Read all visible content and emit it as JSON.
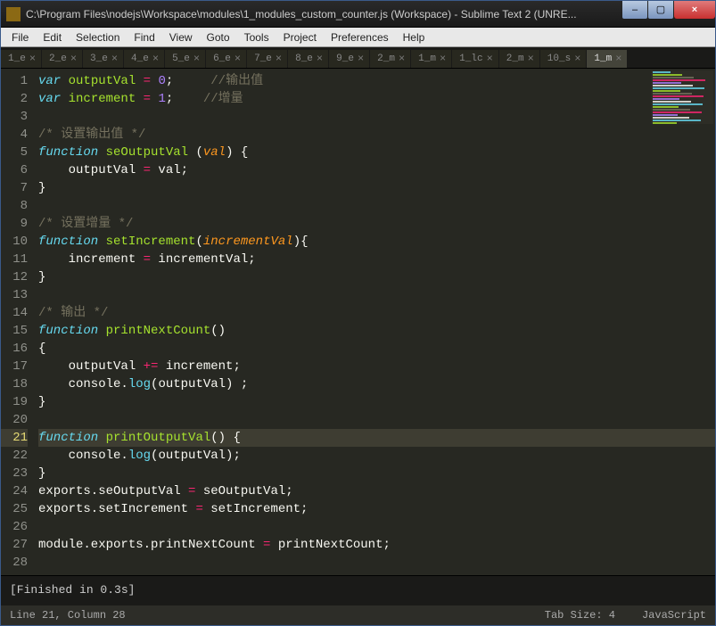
{
  "titlebar": "C:\\Program Files\\nodejs\\Workspace\\modules\\1_modules_custom_counter.js (Workspace) - Sublime Text 2 (UNRE...",
  "menu": [
    "File",
    "Edit",
    "Selection",
    "Find",
    "View",
    "Goto",
    "Tools",
    "Project",
    "Preferences",
    "Help"
  ],
  "tabs": [
    "1_e",
    "2_e",
    "3_e",
    "4_e",
    "5_e",
    "6_e",
    "7_e",
    "8_e",
    "9_e",
    "2_m",
    "1_m",
    "1_lc",
    "2_m",
    "10_s",
    "1_m"
  ],
  "active_tab_index": 14,
  "window_controls": {
    "min": "–",
    "max": "▢",
    "close": "×"
  },
  "tab_close_glyph": "×",
  "code_lines": [
    [
      [
        "decl",
        "var "
      ],
      [
        "name",
        "outputVal"
      ],
      [
        "",
        ""
      ],
      [
        "",
        " "
      ],
      [
        "op",
        "="
      ],
      [
        "",
        " "
      ],
      [
        "num",
        "0"
      ],
      [
        "",
        ";     "
      ],
      [
        "cmt",
        "//输出值"
      ]
    ],
    [
      [
        "decl",
        "var "
      ],
      [
        "name",
        "increment"
      ],
      [
        "",
        " "
      ],
      [
        "op",
        "="
      ],
      [
        "",
        " "
      ],
      [
        "num",
        "1"
      ],
      [
        "",
        ";    "
      ],
      [
        "cmt",
        "//增量"
      ]
    ],
    [
      [
        "",
        ""
      ]
    ],
    [
      [
        "cmt",
        "/* 设置输出值 */"
      ]
    ],
    [
      [
        "decl",
        "function"
      ],
      [
        "",
        " "
      ],
      [
        "name",
        "seOutputVal"
      ],
      [
        "",
        " ("
      ],
      [
        "str-param",
        "val"
      ],
      [
        "",
        ") {"
      ]
    ],
    [
      [
        "",
        "    outputVal "
      ],
      [
        "op",
        "="
      ],
      [
        "",
        " val;"
      ]
    ],
    [
      [
        "",
        "}"
      ]
    ],
    [
      [
        "",
        ""
      ]
    ],
    [
      [
        "cmt",
        "/* 设置增量 */"
      ]
    ],
    [
      [
        "decl",
        "function"
      ],
      [
        "",
        " "
      ],
      [
        "name",
        "setIncrement"
      ],
      [
        "",
        "("
      ],
      [
        "str-param",
        "incrementVal"
      ],
      [
        "",
        "){"
      ]
    ],
    [
      [
        "",
        "    increment "
      ],
      [
        "op",
        "="
      ],
      [
        "",
        " incrementVal;"
      ]
    ],
    [
      [
        "",
        "}"
      ]
    ],
    [
      [
        "",
        ""
      ]
    ],
    [
      [
        "cmt",
        "/* 输出 */"
      ]
    ],
    [
      [
        "decl",
        "function"
      ],
      [
        "",
        " "
      ],
      [
        "name",
        "printNextCount"
      ],
      [
        "",
        "()"
      ]
    ],
    [
      [
        "",
        "{"
      ]
    ],
    [
      [
        "",
        "    outputVal "
      ],
      [
        "op",
        "+="
      ],
      [
        "",
        " increment;"
      ]
    ],
    [
      [
        "",
        "    console."
      ],
      [
        "fn",
        "log"
      ],
      [
        "",
        "(outputVal) ;"
      ]
    ],
    [
      [
        "",
        "}"
      ]
    ],
    [
      [
        "",
        ""
      ]
    ],
    [
      [
        "decl",
        "function"
      ],
      [
        "",
        " "
      ],
      [
        "name",
        "printOutputVal"
      ],
      [
        "",
        "() {"
      ]
    ],
    [
      [
        "",
        "    console."
      ],
      [
        "fn",
        "log"
      ],
      [
        "",
        "(outputVal);"
      ]
    ],
    [
      [
        "",
        "}"
      ]
    ],
    [
      [
        "",
        "exports.seOutputVal "
      ],
      [
        "op",
        "="
      ],
      [
        "",
        " seOutputVal;"
      ]
    ],
    [
      [
        "",
        "exports.setIncrement "
      ],
      [
        "op",
        "="
      ],
      [
        "",
        " setIncrement;"
      ]
    ],
    [
      [
        "",
        ""
      ]
    ],
    [
      [
        "",
        "module.exports.printNextCount "
      ],
      [
        "op",
        "="
      ],
      [
        "",
        " printNextCount;"
      ]
    ],
    [
      [
        "",
        ""
      ]
    ]
  ],
  "highlighted_line": 21,
  "console_output": "[Finished in 0.3s]",
  "status": {
    "position": "Line 21, Column 28",
    "tab_size": "Tab Size: 4",
    "syntax": "JavaScript"
  }
}
